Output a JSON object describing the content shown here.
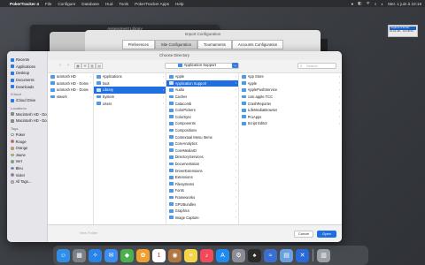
{
  "menubar": {
    "apple": "",
    "app_name": "PokerTracker 4",
    "items": [
      "File",
      "Configure",
      "Database",
      "Hud",
      "Tools",
      "PokerTracker Apps",
      "Help"
    ],
    "clock": "Mer. 1 juin à 10:18",
    "status_icons": [
      "●",
      "◧",
      "ᯤ",
      "⌕",
      "◐"
    ]
  },
  "screenshot_thumb": {
    "label": "Capture d'écran",
    "sub": "10.21.48... 10.18.53"
  },
  "back_window": {
    "title": "Assessment Library",
    "tabs": [
      "Community",
      "N..."
    ]
  },
  "config_window": {
    "title": "Import Configuration",
    "tabs": [
      "Preferences",
      "Site Configuration",
      "Tournaments",
      "Accounts Configuration"
    ],
    "active_tab": 1
  },
  "dialog": {
    "title": "Choose Directory",
    "nav": {
      "back": "‹",
      "forward": "›"
    },
    "view_buttons": [
      "▦",
      "☰",
      "▥",
      "▤"
    ],
    "location": "Application Support",
    "location_chevron": "⌄",
    "search_placeholder": "Search",
    "sidebar": {
      "favorites_items": [
        {
          "icon": "recents-icon",
          "label": "Recents",
          "color": "#2a7ae2"
        },
        {
          "icon": "applications-icon",
          "label": "Applications",
          "color": "#2a7ae2"
        },
        {
          "icon": "desktop-icon",
          "label": "Desktop",
          "color": "#2a7ae2"
        },
        {
          "icon": "documents-icon",
          "label": "Documents",
          "color": "#2a7ae2"
        },
        {
          "icon": "downloads-icon",
          "label": "Downloads",
          "color": "#2a7ae2"
        }
      ],
      "icloud_section": "iCloud",
      "icloud_items": [
        {
          "icon": "icloud-icon",
          "label": "iCloud Drive",
          "color": "#2a7ae2"
        }
      ],
      "locations_section": "Locations",
      "locations_items": [
        {
          "icon": "disk-icon",
          "label": "Macintosh HD - Données",
          "color": "#888888"
        },
        {
          "icon": "disk-icon",
          "label": "Macintosh HD - Données",
          "color": "#888888"
        }
      ],
      "tags_section": "Tags",
      "tags": [
        {
          "label": "Poker",
          "color": "#ffffff"
        },
        {
          "label": "Rouge",
          "color": "#ff3b30"
        },
        {
          "label": "Orange",
          "color": "#ff9500"
        },
        {
          "label": "Jaune",
          "color": "#ffcc00"
        },
        {
          "label": "Vert",
          "color": "#34c759"
        },
        {
          "label": "Bleu",
          "color": "#007aff"
        },
        {
          "label": "Violet",
          "color": "#af52de"
        },
        {
          "label": "All Tags...",
          "color": "#bbbbbb"
        }
      ]
    },
    "columns": [
      {
        "items": [
          {
            "label": "acintosh HD",
            "chev": true
          },
          {
            "label": "acintosh HD - Données",
            "chev": true
          },
          {
            "label": "acintosh HD - Données",
            "chev": true
          },
          {
            "label": "etwork",
            "chev": true
          }
        ]
      },
      {
        "items": [
          {
            "label": "Applications",
            "chev": true
          },
          {
            "label": "boot",
            "chev": true
          },
          {
            "label": "Library",
            "chev": true,
            "selected": true
          },
          {
            "label": "System",
            "chev": true
          },
          {
            "label": "Users",
            "chev": true
          }
        ]
      },
      {
        "items": [
          {
            "label": "Apple",
            "chev": true
          },
          {
            "label": "Application Support",
            "chev": true,
            "selected": true
          },
          {
            "label": "Audio",
            "chev": true
          },
          {
            "label": "Caches",
            "chev": true
          },
          {
            "label": "Catacomb",
            "chev": true
          },
          {
            "label": "ColorPickers",
            "chev": true
          },
          {
            "label": "ColorSync",
            "chev": true
          },
          {
            "label": "Components",
            "chev": true
          },
          {
            "label": "Compositions",
            "chev": true
          },
          {
            "label": "Contextual Menu Items",
            "chev": true
          },
          {
            "label": "CoreAnalytics",
            "chev": true
          },
          {
            "label": "CoreMediaIO",
            "chev": true
          },
          {
            "label": "DirectoryServices",
            "chev": true
          },
          {
            "label": "Documentation",
            "chev": true
          },
          {
            "label": "DriverExtensions",
            "chev": true
          },
          {
            "label": "Extensions",
            "chev": true
          },
          {
            "label": "Filesystems",
            "chev": true
          },
          {
            "label": "Fonts",
            "chev": true
          },
          {
            "label": "Frameworks",
            "chev": true
          },
          {
            "label": "GPUBundles",
            "chev": true
          },
          {
            "label": "Graphics",
            "chev": true
          },
          {
            "label": "Image Capture",
            "chev": true
          }
        ]
      },
      {
        "items": [
          {
            "label": "App Store",
            "chev": true
          },
          {
            "label": "Apple",
            "chev": true
          },
          {
            "label": "ApplePushService",
            "chev": true
          },
          {
            "label": "com.apple.TCC",
            "chev": true
          },
          {
            "label": "CrashReporter",
            "chev": true
          },
          {
            "label": "iLifeMediaBrowser",
            "chev": true
          },
          {
            "label": "ProApps",
            "chev": true
          },
          {
            "label": "Script Editor",
            "chev": true
          }
        ]
      }
    ],
    "new_folder": "New Folder",
    "cancel": "Cancel",
    "open": "Open"
  },
  "dock": [
    {
      "name": "finder-icon",
      "glyph": "☺",
      "color": "#2f8fe8"
    },
    {
      "name": "launchpad-icon",
      "glyph": "▦",
      "color": "#7a7f88"
    },
    {
      "name": "safari-icon",
      "glyph": "✧",
      "color": "#2a84e8"
    },
    {
      "name": "mail-icon",
      "glyph": "✉",
      "color": "#3d8ef0"
    },
    {
      "name": "maps-icon",
      "glyph": "◆",
      "color": "#4caf50"
    },
    {
      "name": "photos-icon",
      "glyph": "✿",
      "color": "#f0a030"
    },
    {
      "name": "calendar-icon",
      "glyph": "1",
      "color": "#ffffff"
    },
    {
      "name": "contacts-icon",
      "glyph": "◉",
      "color": "#b07840"
    },
    {
      "name": "notes-icon",
      "glyph": "≡",
      "color": "#f5d34a"
    },
    {
      "name": "music-icon",
      "glyph": "♪",
      "color": "#f24a5a"
    },
    {
      "name": "appstore-icon",
      "glyph": "A",
      "color": "#1c8cf0"
    },
    {
      "name": "settings-icon",
      "glyph": "⚙",
      "color": "#8a8d93"
    },
    {
      "name": "pokertracker-icon",
      "glyph": "♠",
      "color": "#2a2a2a"
    },
    {
      "name": "monterey-icon",
      "glyph": "≈",
      "color": "#3a6fd0"
    },
    {
      "name": "preview-icon",
      "glyph": "▤",
      "color": "#6aa0e0"
    },
    {
      "name": "xcode-icon",
      "glyph": "✕",
      "color": "#2a6ad8"
    },
    {
      "name": "trash-icon",
      "glyph": "▥",
      "color": "#9aa0a8"
    }
  ]
}
